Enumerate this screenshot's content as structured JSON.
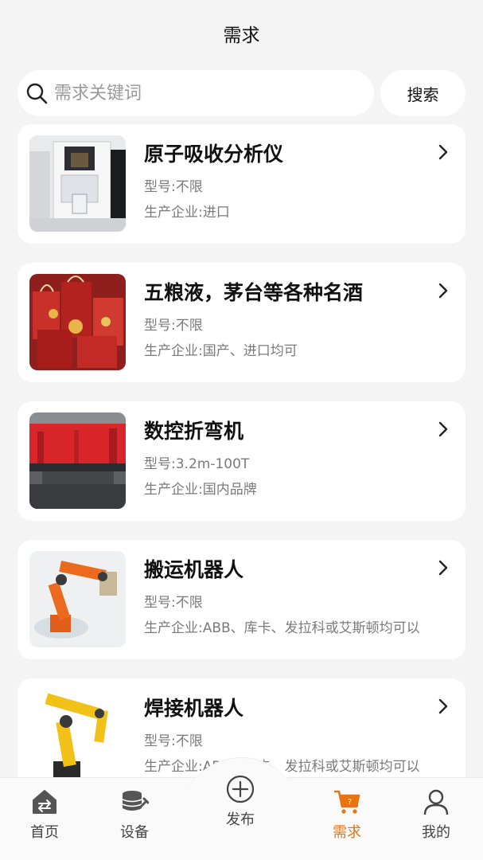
{
  "header": {
    "title": "需求"
  },
  "search": {
    "placeholder": "需求关键词",
    "button_label": "搜索"
  },
  "items": [
    {
      "title": "原子吸收分析仪",
      "model": "型号:不限",
      "maker": "生产企业:进口",
      "image": "lab-instrument-photo"
    },
    {
      "title": "五粮液，茅台等各种名酒",
      "model": "型号:不限",
      "maker": "生产企业:国产、进口均可",
      "image": "liquor-gift-bags-photo"
    },
    {
      "title": "数控折弯机",
      "model": "型号:3.2m-100T",
      "maker": "生产企业:国内品牌",
      "image": "press-brake-photo"
    },
    {
      "title": "搬运机器人",
      "model": "型号:不限",
      "maker": "生产企业:ABB、库卡、发拉科或艾斯顿均可以",
      "image": "orange-robot-arm-photo"
    },
    {
      "title": "焊接机器人",
      "model": "型号:不限",
      "maker": "生产企业:ABB、库卡、发拉科或艾斯顿均可以",
      "image": "yellow-robot-arm-photo"
    }
  ],
  "tabbar": {
    "tabs": [
      {
        "label": "首页",
        "icon": "home-icon"
      },
      {
        "label": "设备",
        "icon": "equipment-icon"
      },
      {
        "label": "发布",
        "icon": "publish-plus-icon"
      },
      {
        "label": "需求",
        "icon": "cart-question-icon",
        "active": true
      },
      {
        "label": "我的",
        "icon": "user-icon"
      }
    ]
  },
  "colors": {
    "accent": "#e8730f",
    "background": "#f4f4f4",
    "card": "#ffffff"
  }
}
